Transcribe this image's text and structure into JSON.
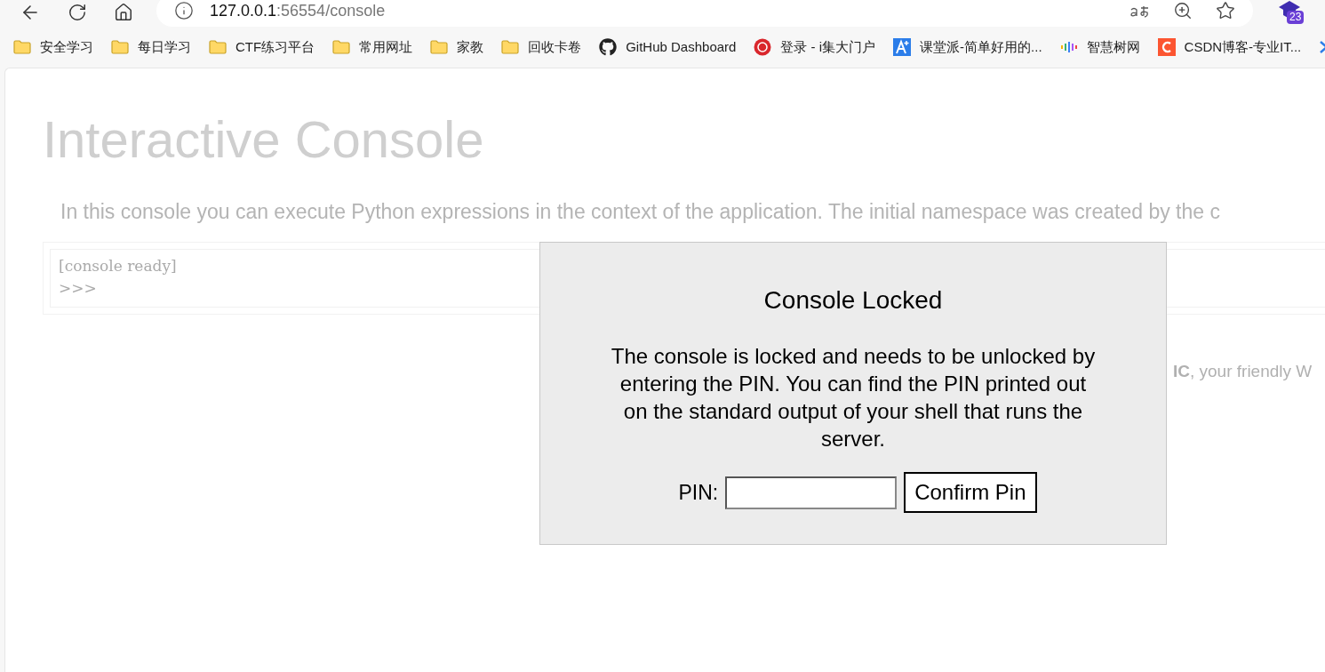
{
  "browser": {
    "url_host": "127.0.0.1",
    "url_rest": ":56554/console",
    "extension_badge": "23"
  },
  "bookmarks": [
    {
      "label": "安全学习",
      "kind": "folder"
    },
    {
      "label": "每日学习",
      "kind": "folder"
    },
    {
      "label": "CTF练习平台",
      "kind": "folder"
    },
    {
      "label": "常用网址",
      "kind": "folder"
    },
    {
      "label": "家教",
      "kind": "folder"
    },
    {
      "label": "回收卡卷",
      "kind": "folder"
    },
    {
      "label": "GitHub Dashboard",
      "kind": "github"
    },
    {
      "label": "登录 - i集大门户",
      "kind": "seal"
    },
    {
      "label": "课堂派-简单好用的...",
      "kind": "letter"
    },
    {
      "label": "智慧树网",
      "kind": "bars"
    },
    {
      "label": "CSDN博客-专业IT...",
      "kind": "csdn"
    },
    {
      "kind": "partial"
    }
  ],
  "page": {
    "title": "Interactive Console",
    "intro": "In this console you can execute Python expressions in the context of the application. The initial namespace was created by the c",
    "console_lines": [
      "[console ready]",
      ">>>"
    ],
    "footer": "**IC**, your friendly W"
  },
  "dialog": {
    "title": "Console Locked",
    "message": "The console is locked and needs to be unlocked by entering the PIN. You can find the PIN printed out on the standard output of your shell that runs the server.",
    "pin_label": "PIN:",
    "confirm_button": "Confirm Pin"
  }
}
